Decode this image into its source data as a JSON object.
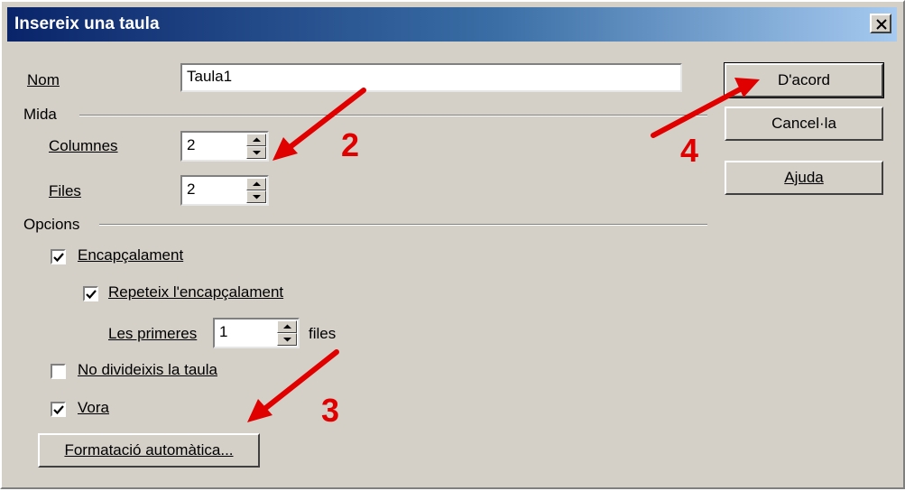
{
  "dialog": {
    "title": "Insereix una taula",
    "close_glyph": "×"
  },
  "name": {
    "label": "Nom",
    "value": "Taula1"
  },
  "size": {
    "label": "Mida",
    "columns": {
      "label": "Columnes",
      "value": "2"
    },
    "rows": {
      "label": "Files",
      "value": "2"
    }
  },
  "options": {
    "label": "Opcions",
    "heading": {
      "label": "Encapçalament",
      "checked": true
    },
    "repeat_heading": {
      "label": "Repeteix l'encapçalament",
      "checked": true
    },
    "first_rows": {
      "label": "Les primeres",
      "value": "1",
      "suffix": "files"
    },
    "no_split": {
      "label": "No divideixis la taula",
      "checked": false
    },
    "border": {
      "label": "Vora",
      "checked": true
    }
  },
  "buttons": {
    "autoformat": "Formatació automàtica...",
    "ok": "D'acord",
    "cancel": "Cancel·la",
    "help": "Ajuda"
  },
  "annotations": {
    "color": "#e00000",
    "step2": "2",
    "step3": "3",
    "step4": "4"
  }
}
